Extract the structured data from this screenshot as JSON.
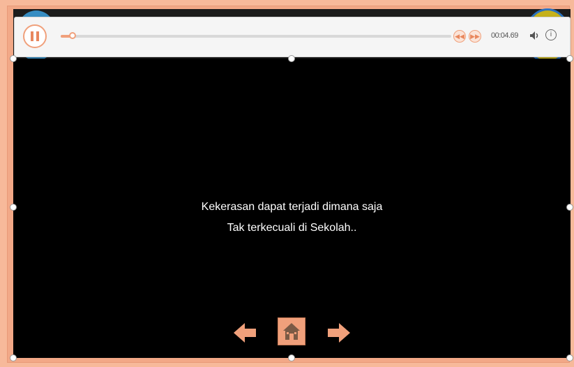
{
  "player": {
    "pause_icon": "pause-icon",
    "progress_fraction": 0.03,
    "rewind_icon": "rewind-icon",
    "forward_icon": "forward-icon",
    "time": "00:04.69",
    "volume_icon": "volume-icon",
    "info_icon": "info-icon"
  },
  "slide": {
    "line1": "Kekerasan dapat terjadi dimana saja",
    "line2": "Tak terkecuali di Sekolah.."
  },
  "nav": {
    "prev_icon": "arrow-left-icon",
    "home_icon": "home-icon",
    "next_icon": "arrow-right-icon"
  },
  "colors": {
    "accent": "#f0a07b",
    "background": "#000000",
    "frame": "#f7b99a"
  }
}
